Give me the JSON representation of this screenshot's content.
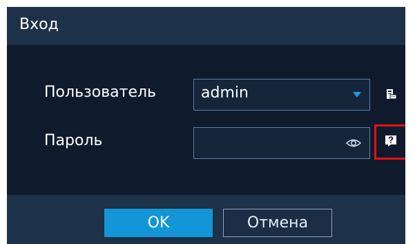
{
  "dialog": {
    "title": "Вход"
  },
  "form": {
    "user_label": "Пользователь",
    "user_value": "admin",
    "password_label": "Пароль",
    "password_value": ""
  },
  "icons": {
    "dropdown": "chevron-down-icon",
    "password_visibility": "eye-icon",
    "keyboard": "keyboard-icon",
    "help": "question-icon"
  },
  "buttons": {
    "ok_label": "OK",
    "cancel_label": "Отмена"
  },
  "colors": {
    "accent": "#1296d8",
    "highlight": "#e81010",
    "background": "#0f1b2c",
    "bar": "#1d3148"
  }
}
